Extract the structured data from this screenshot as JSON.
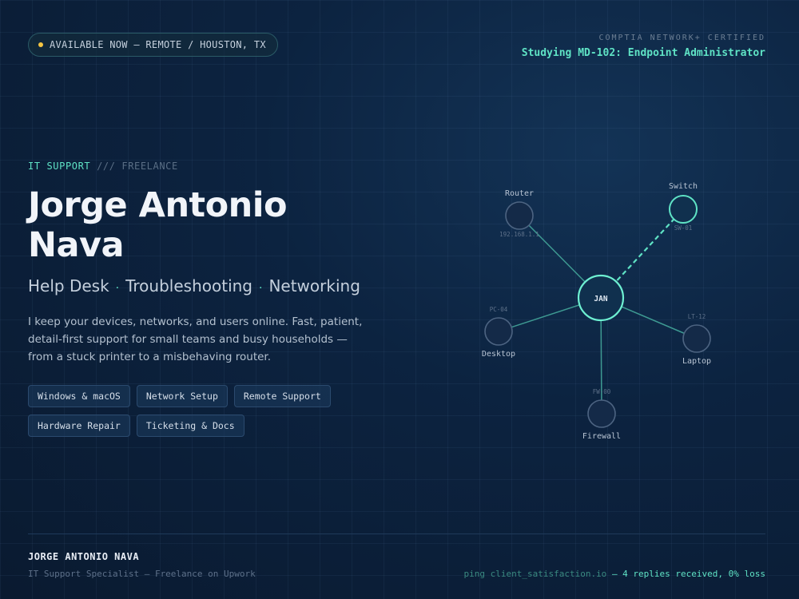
{
  "header": {
    "status": "AVAILABLE NOW — REMOTE / HOUSTON, TX",
    "cert_label": "COMPTIA NETWORK+ CERTIFIED",
    "cert_title": "Studying MD-102: Endpoint Administrator"
  },
  "hero": {
    "eyebrow_primary": "IT SUPPORT",
    "eyebrow_secondary": "/// FREELANCE",
    "name": "Jorge Antonio Nava",
    "specialties": [
      "Help Desk",
      "Troubleshooting",
      "Networking"
    ],
    "specialty_separator": "·",
    "bio": "I keep your devices, networks, and users online. Fast, patient, detail-first support for small teams and busy households — from a stuck printer to a misbehaving router."
  },
  "skills": [
    "Windows & macOS",
    "Network Setup",
    "Remote Support",
    "Hardware Repair",
    "Ticketing & Docs"
  ],
  "network": {
    "hub": "JAN",
    "nodes": {
      "router": {
        "label": "Router",
        "sub": "192.168.1.1"
      },
      "switch": {
        "label": "Switch",
        "sub": "SW-01"
      },
      "desktop": {
        "label": "Desktop",
        "sub": "PC-04"
      },
      "laptop": {
        "label": "Laptop",
        "sub": "LT-12"
      },
      "firewall": {
        "label": "Firewall",
        "sub": "FW-00"
      }
    }
  },
  "footer": {
    "name": "JORGE ANTONIO NAVA",
    "role": "IT Support Specialist — Freelance on Upwork",
    "ping_cmd": "ping client_satisfaction.io",
    "ping_result": "— 4 replies received, 0% loss"
  },
  "colors": {
    "accent": "#5fe3c5",
    "status_dot": "#f5c542",
    "background": "#0c2340"
  }
}
